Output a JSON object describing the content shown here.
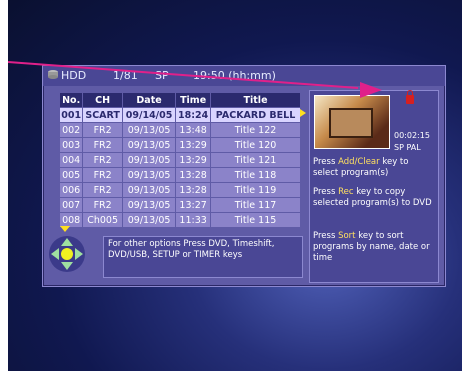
{
  "topbar": {
    "source": "HDD",
    "count": "1/81",
    "mode": "SP",
    "time": "19:50 (hh:mm)"
  },
  "table": {
    "headers": [
      "No.",
      "CH",
      "Date",
      "Time",
      "Title"
    ],
    "rows": [
      [
        "001",
        "SCART",
        "09/14/05",
        "18:24",
        "PACKARD BELL"
      ],
      [
        "002",
        "FR2",
        "09/13/05",
        "13:48",
        "Title 122"
      ],
      [
        "003",
        "FR2",
        "09/13/05",
        "13:29",
        "Title 120"
      ],
      [
        "004",
        "FR2",
        "09/13/05",
        "13:29",
        "Title 121"
      ],
      [
        "005",
        "FR2",
        "09/13/05",
        "13:28",
        "Title 118"
      ],
      [
        "006",
        "FR2",
        "09/13/05",
        "13:28",
        "Title 119"
      ],
      [
        "007",
        "FR2",
        "09/13/05",
        "13:27",
        "Title 117"
      ],
      [
        "008",
        "Ch005",
        "09/13/05",
        "11:33",
        "Title 115"
      ]
    ]
  },
  "preview": {
    "duration": "00:02:15",
    "format": "SP PAL"
  },
  "help": {
    "h1": "Press",
    "k1": "Add/Clear",
    "t1": "key to select program(s)",
    "h2": "Press",
    "k2": "Rec",
    "t2": "key to copy selected program(s) to DVD",
    "h3": "Press",
    "k3": "Sort",
    "t3": "key to sort programs by name, date or time"
  },
  "info": "For other options Press DVD, Timeshift, DVD/USB, SETUP or TIMER keys",
  "colors": {
    "panel": "#5f5ba6",
    "selected_row": "#d9d4ff",
    "accent": "#ffe060",
    "pointer": "#e0208a"
  }
}
